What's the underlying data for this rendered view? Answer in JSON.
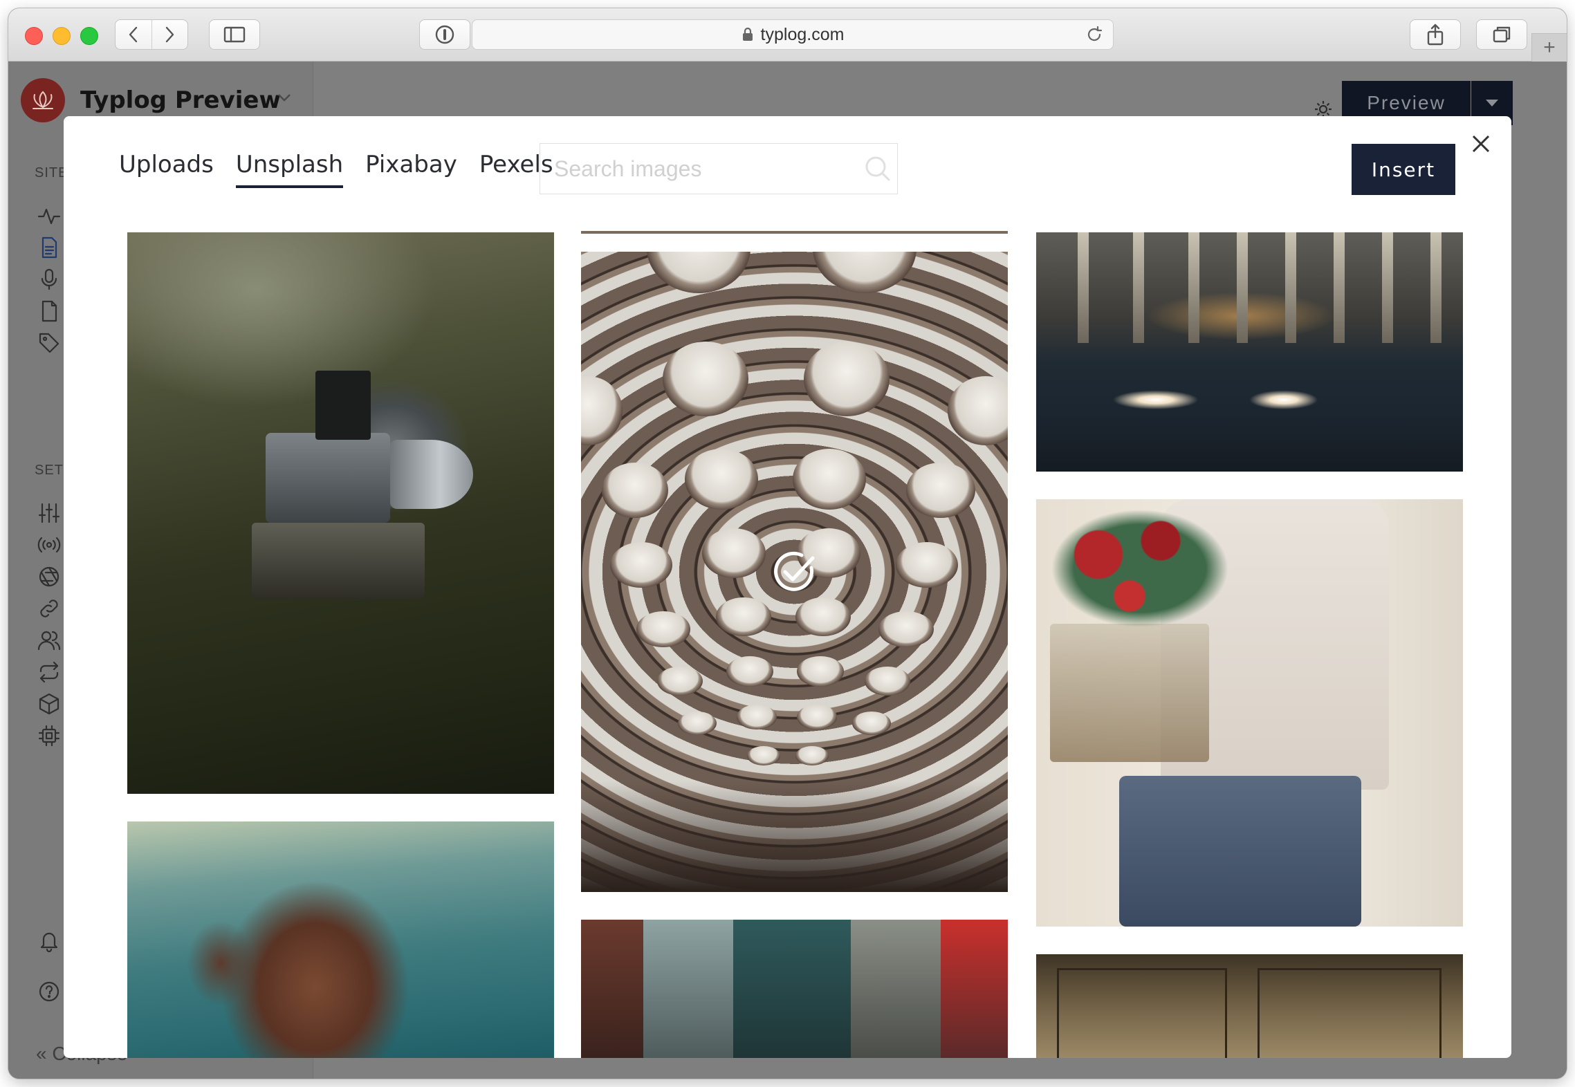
{
  "browser": {
    "url": "typlog.com"
  },
  "app": {
    "site_name": "Typlog Preview",
    "sidebar_section_site": "SITE",
    "sidebar_section_settings": "SET",
    "collapse_label": "Collapse",
    "preview_label": "Preview"
  },
  "modal": {
    "tabs": [
      {
        "label": "Uploads",
        "active": false
      },
      {
        "label": "Unsplash",
        "active": true
      },
      {
        "label": "Pixabay",
        "active": false
      },
      {
        "label": "Pexels",
        "active": false
      }
    ],
    "search": {
      "placeholder": "Search images",
      "value": ""
    },
    "insert_label": "Insert"
  },
  "icons": {
    "close": "close-icon",
    "search": "search-icon",
    "selected": "check-circle-icon"
  },
  "colors": {
    "accent": "#1a2238",
    "overlay": "#7f7f7f",
    "logo": "#7a2422"
  }
}
